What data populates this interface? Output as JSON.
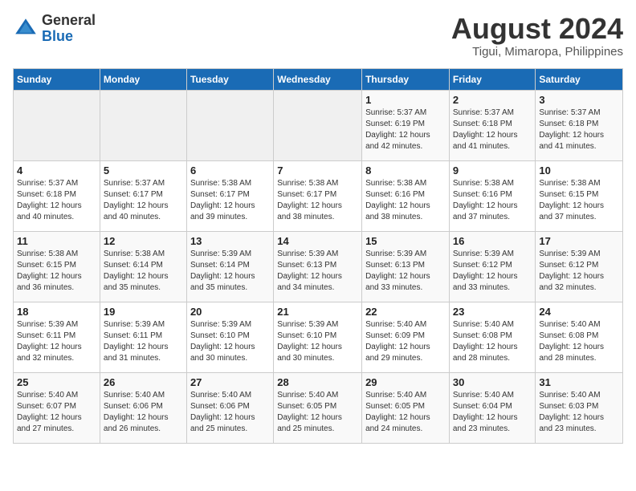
{
  "header": {
    "logo_general": "General",
    "logo_blue": "Blue",
    "month_year": "August 2024",
    "location": "Tigui, Mimaropa, Philippines"
  },
  "weekdays": [
    "Sunday",
    "Monday",
    "Tuesday",
    "Wednesday",
    "Thursday",
    "Friday",
    "Saturday"
  ],
  "weeks": [
    [
      {
        "day": "",
        "info": ""
      },
      {
        "day": "",
        "info": ""
      },
      {
        "day": "",
        "info": ""
      },
      {
        "day": "",
        "info": ""
      },
      {
        "day": "1",
        "info": "Sunrise: 5:37 AM\nSunset: 6:19 PM\nDaylight: 12 hours\nand 42 minutes."
      },
      {
        "day": "2",
        "info": "Sunrise: 5:37 AM\nSunset: 6:18 PM\nDaylight: 12 hours\nand 41 minutes."
      },
      {
        "day": "3",
        "info": "Sunrise: 5:37 AM\nSunset: 6:18 PM\nDaylight: 12 hours\nand 41 minutes."
      }
    ],
    [
      {
        "day": "4",
        "info": "Sunrise: 5:37 AM\nSunset: 6:18 PM\nDaylight: 12 hours\nand 40 minutes."
      },
      {
        "day": "5",
        "info": "Sunrise: 5:37 AM\nSunset: 6:17 PM\nDaylight: 12 hours\nand 40 minutes."
      },
      {
        "day": "6",
        "info": "Sunrise: 5:38 AM\nSunset: 6:17 PM\nDaylight: 12 hours\nand 39 minutes."
      },
      {
        "day": "7",
        "info": "Sunrise: 5:38 AM\nSunset: 6:17 PM\nDaylight: 12 hours\nand 38 minutes."
      },
      {
        "day": "8",
        "info": "Sunrise: 5:38 AM\nSunset: 6:16 PM\nDaylight: 12 hours\nand 38 minutes."
      },
      {
        "day": "9",
        "info": "Sunrise: 5:38 AM\nSunset: 6:16 PM\nDaylight: 12 hours\nand 37 minutes."
      },
      {
        "day": "10",
        "info": "Sunrise: 5:38 AM\nSunset: 6:15 PM\nDaylight: 12 hours\nand 37 minutes."
      }
    ],
    [
      {
        "day": "11",
        "info": "Sunrise: 5:38 AM\nSunset: 6:15 PM\nDaylight: 12 hours\nand 36 minutes."
      },
      {
        "day": "12",
        "info": "Sunrise: 5:38 AM\nSunset: 6:14 PM\nDaylight: 12 hours\nand 35 minutes."
      },
      {
        "day": "13",
        "info": "Sunrise: 5:39 AM\nSunset: 6:14 PM\nDaylight: 12 hours\nand 35 minutes."
      },
      {
        "day": "14",
        "info": "Sunrise: 5:39 AM\nSunset: 6:13 PM\nDaylight: 12 hours\nand 34 minutes."
      },
      {
        "day": "15",
        "info": "Sunrise: 5:39 AM\nSunset: 6:13 PM\nDaylight: 12 hours\nand 33 minutes."
      },
      {
        "day": "16",
        "info": "Sunrise: 5:39 AM\nSunset: 6:12 PM\nDaylight: 12 hours\nand 33 minutes."
      },
      {
        "day": "17",
        "info": "Sunrise: 5:39 AM\nSunset: 6:12 PM\nDaylight: 12 hours\nand 32 minutes."
      }
    ],
    [
      {
        "day": "18",
        "info": "Sunrise: 5:39 AM\nSunset: 6:11 PM\nDaylight: 12 hours\nand 32 minutes."
      },
      {
        "day": "19",
        "info": "Sunrise: 5:39 AM\nSunset: 6:11 PM\nDaylight: 12 hours\nand 31 minutes."
      },
      {
        "day": "20",
        "info": "Sunrise: 5:39 AM\nSunset: 6:10 PM\nDaylight: 12 hours\nand 30 minutes."
      },
      {
        "day": "21",
        "info": "Sunrise: 5:39 AM\nSunset: 6:10 PM\nDaylight: 12 hours\nand 30 minutes."
      },
      {
        "day": "22",
        "info": "Sunrise: 5:40 AM\nSunset: 6:09 PM\nDaylight: 12 hours\nand 29 minutes."
      },
      {
        "day": "23",
        "info": "Sunrise: 5:40 AM\nSunset: 6:08 PM\nDaylight: 12 hours\nand 28 minutes."
      },
      {
        "day": "24",
        "info": "Sunrise: 5:40 AM\nSunset: 6:08 PM\nDaylight: 12 hours\nand 28 minutes."
      }
    ],
    [
      {
        "day": "25",
        "info": "Sunrise: 5:40 AM\nSunset: 6:07 PM\nDaylight: 12 hours\nand 27 minutes."
      },
      {
        "day": "26",
        "info": "Sunrise: 5:40 AM\nSunset: 6:06 PM\nDaylight: 12 hours\nand 26 minutes."
      },
      {
        "day": "27",
        "info": "Sunrise: 5:40 AM\nSunset: 6:06 PM\nDaylight: 12 hours\nand 25 minutes."
      },
      {
        "day": "28",
        "info": "Sunrise: 5:40 AM\nSunset: 6:05 PM\nDaylight: 12 hours\nand 25 minutes."
      },
      {
        "day": "29",
        "info": "Sunrise: 5:40 AM\nSunset: 6:05 PM\nDaylight: 12 hours\nand 24 minutes."
      },
      {
        "day": "30",
        "info": "Sunrise: 5:40 AM\nSunset: 6:04 PM\nDaylight: 12 hours\nand 23 minutes."
      },
      {
        "day": "31",
        "info": "Sunrise: 5:40 AM\nSunset: 6:03 PM\nDaylight: 12 hours\nand 23 minutes."
      }
    ]
  ]
}
